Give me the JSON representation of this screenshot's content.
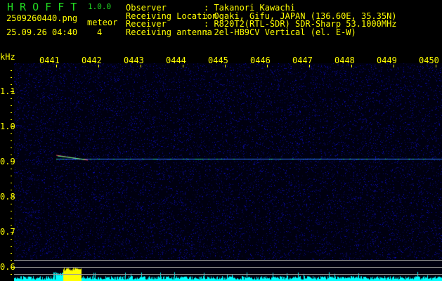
{
  "app": {
    "name": "H R O F F T",
    "version": "1.0.0"
  },
  "file": "2509260440.png",
  "datetime": "25.09.26 04:40",
  "meteor_label": "meteor",
  "meteor_count": "4",
  "info": [
    {
      "label": "Observer",
      "value": ": Takanori Kawachi"
    },
    {
      "label": "Receiving Location",
      "value": ": Ogaki, Gifu, JAPAN (136.60E, 35.35N)"
    },
    {
      "label": "Receiver",
      "value": ": R820T2(RTL-SDR) SDR-Sharp 53.1000MHz"
    },
    {
      "label": "Receiving antenna",
      "value": ": 2el-HB9CV Vertical (el. E-W)"
    }
  ],
  "y_unit": "kHz",
  "y_labels": [
    "1.1",
    "1.0",
    "0.9",
    "0.8",
    "0.7",
    "0.6"
  ],
  "x_labels": [
    "0441",
    "0442",
    "0443",
    "0444",
    "0445",
    "0446",
    "0447",
    "0448",
    "0449",
    "0450"
  ],
  "colors": {
    "text": "#ffff00",
    "title": "#22dd22",
    "noise": "#1a1aa0",
    "signal": "#00ffff",
    "meteor": "#ffff00"
  }
}
